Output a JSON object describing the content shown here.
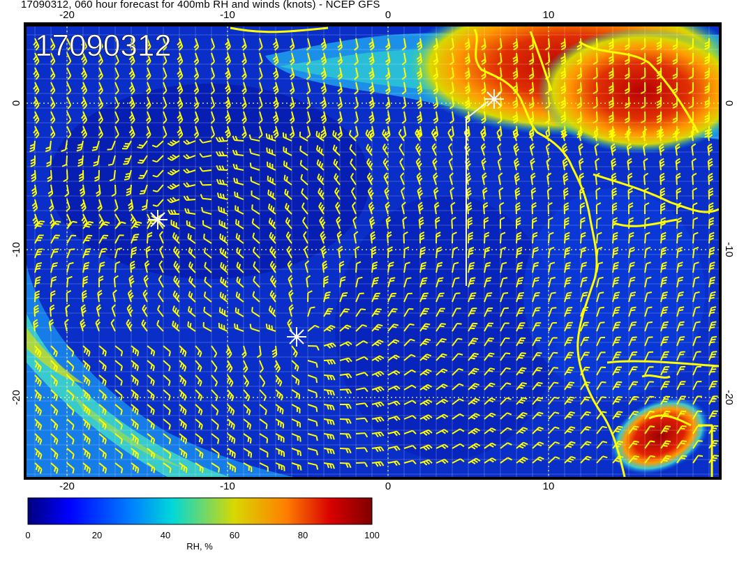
{
  "title": "17090312, 060 hour forecast for 400mb RH and winds (knots) - NCEP GFS",
  "stamp": "17090312",
  "axes": {
    "x_ticks": [
      "-20",
      "-10",
      "0",
      "10"
    ],
    "y_ticks": [
      "0",
      "-10",
      "-20"
    ]
  },
  "colorbar": {
    "title": "RH, %",
    "ticks": [
      "0",
      "20",
      "40",
      "60",
      "80",
      "100"
    ],
    "colors": [
      "#00007f",
      "#0000ff",
      "#007fff",
      "#00d8d8",
      "#d8d800",
      "#ff7f00",
      "#d80000",
      "#7f0000"
    ]
  },
  "colors": {
    "background_field": "#0a2fc8",
    "barbs": "#ffff00",
    "coastline": "#ffff00",
    "markers": "#ffffff"
  }
}
